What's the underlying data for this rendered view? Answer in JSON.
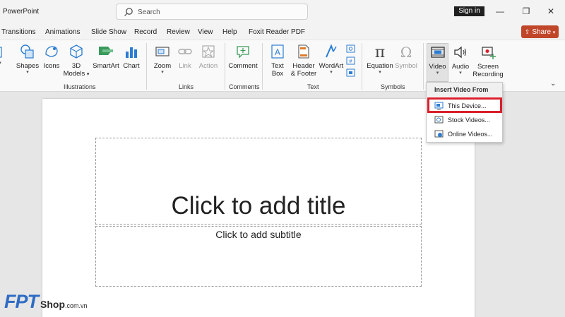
{
  "window": {
    "app_title": "PowerPoint",
    "search_placeholder": "Search",
    "sign_in": "Sign in",
    "share": "Share"
  },
  "tabs": [
    "Transitions",
    "Animations",
    "Slide Show",
    "Record",
    "Review",
    "View",
    "Help",
    "Foxit Reader PDF"
  ],
  "ribbon": {
    "illustrations": {
      "label": "Illustrations",
      "buttons": [
        {
          "line1": "Shapes",
          "line2": ""
        },
        {
          "line1": "Icons",
          "line2": ""
        },
        {
          "line1": "3D",
          "line2": "Models"
        },
        {
          "line1": "SmartArt",
          "line2": ""
        },
        {
          "line1": "Chart",
          "line2": ""
        }
      ]
    },
    "links": {
      "label": "Links",
      "buttons": [
        {
          "line1": "Zoom"
        },
        {
          "line1": "Link"
        },
        {
          "line1": "Action"
        }
      ]
    },
    "comments": {
      "label": "Comments",
      "buttons": [
        {
          "line1": "Comment"
        }
      ]
    },
    "text": {
      "label": "Text",
      "buttons": [
        {
          "line1": "Text",
          "line2": "Box"
        },
        {
          "line1": "Header",
          "line2": "& Footer"
        },
        {
          "line1": "WordArt"
        }
      ]
    },
    "symbols": {
      "label": "Symbols",
      "buttons": [
        {
          "line1": "Equation"
        },
        {
          "line1": "Symbol"
        }
      ]
    },
    "media": {
      "buttons": [
        {
          "line1": "Video"
        },
        {
          "line1": "Audio"
        },
        {
          "line1": "Screen",
          "line2": "Recording"
        }
      ]
    },
    "colors": {
      "accent": "#c0462a",
      "highlight": "#d91f2c",
      "blue": "#2b7cd3"
    }
  },
  "slide": {
    "title_placeholder": "Click to add title",
    "subtitle_placeholder": "Click to add subtitle"
  },
  "video_menu": {
    "header": "Insert Video From",
    "items": [
      "This Device...",
      "Stock Videos...",
      "Online Videos..."
    ]
  },
  "watermark": {
    "brand": "FPT",
    "suffix": "Shop",
    "domain": ".com.vn"
  }
}
